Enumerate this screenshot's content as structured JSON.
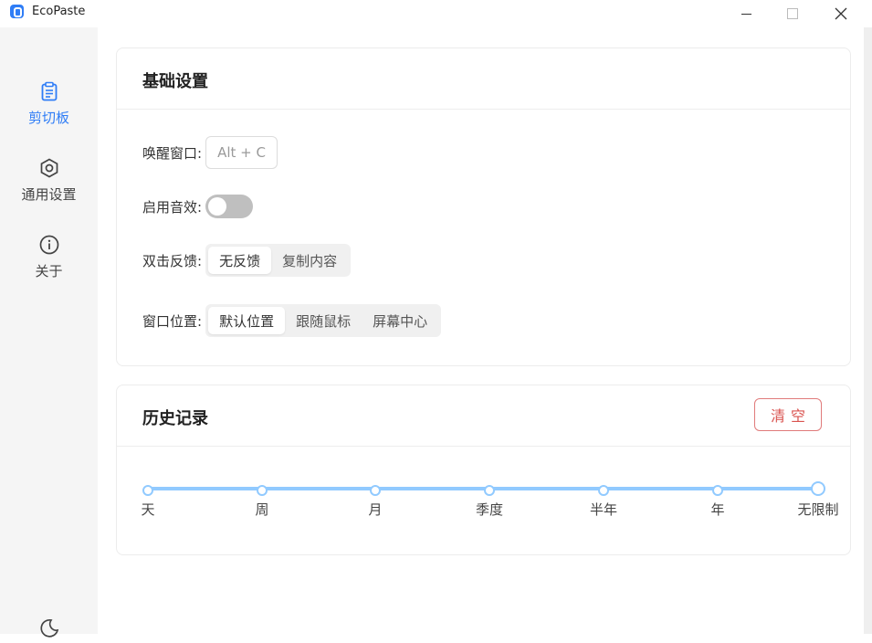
{
  "app": {
    "title": "EcoPaste"
  },
  "sidebar": {
    "items": [
      {
        "label": "剪切板",
        "icon": "clipboard-icon",
        "active": true
      },
      {
        "label": "通用设置",
        "icon": "hexagon-settings-icon",
        "active": false
      },
      {
        "label": "关于",
        "icon": "info-circle-icon",
        "active": false
      }
    ],
    "theme_icon": "moon-icon"
  },
  "basic": {
    "title": "基础设置",
    "wake_label": "唤醒窗口:",
    "wake_shortcut": "Alt + C",
    "sound_label": "启用音效:",
    "sound_enabled": false,
    "double_click_label": "双击反馈:",
    "double_click_options": [
      "无反馈",
      "复制内容"
    ],
    "double_click_selected": "无反馈",
    "window_pos_label": "窗口位置:",
    "window_pos_options": [
      "默认位置",
      "跟随鼠标",
      "屏幕中心"
    ],
    "window_pos_selected": "默认位置"
  },
  "history": {
    "title": "历史记录",
    "clear_label": "清空",
    "marks": [
      "天",
      "周",
      "月",
      "季度",
      "半年",
      "年",
      "无限制"
    ],
    "selected": "无限制"
  },
  "colors": {
    "accent": "#2f7df6",
    "slider": "#91caff",
    "danger": "#d9534f"
  }
}
